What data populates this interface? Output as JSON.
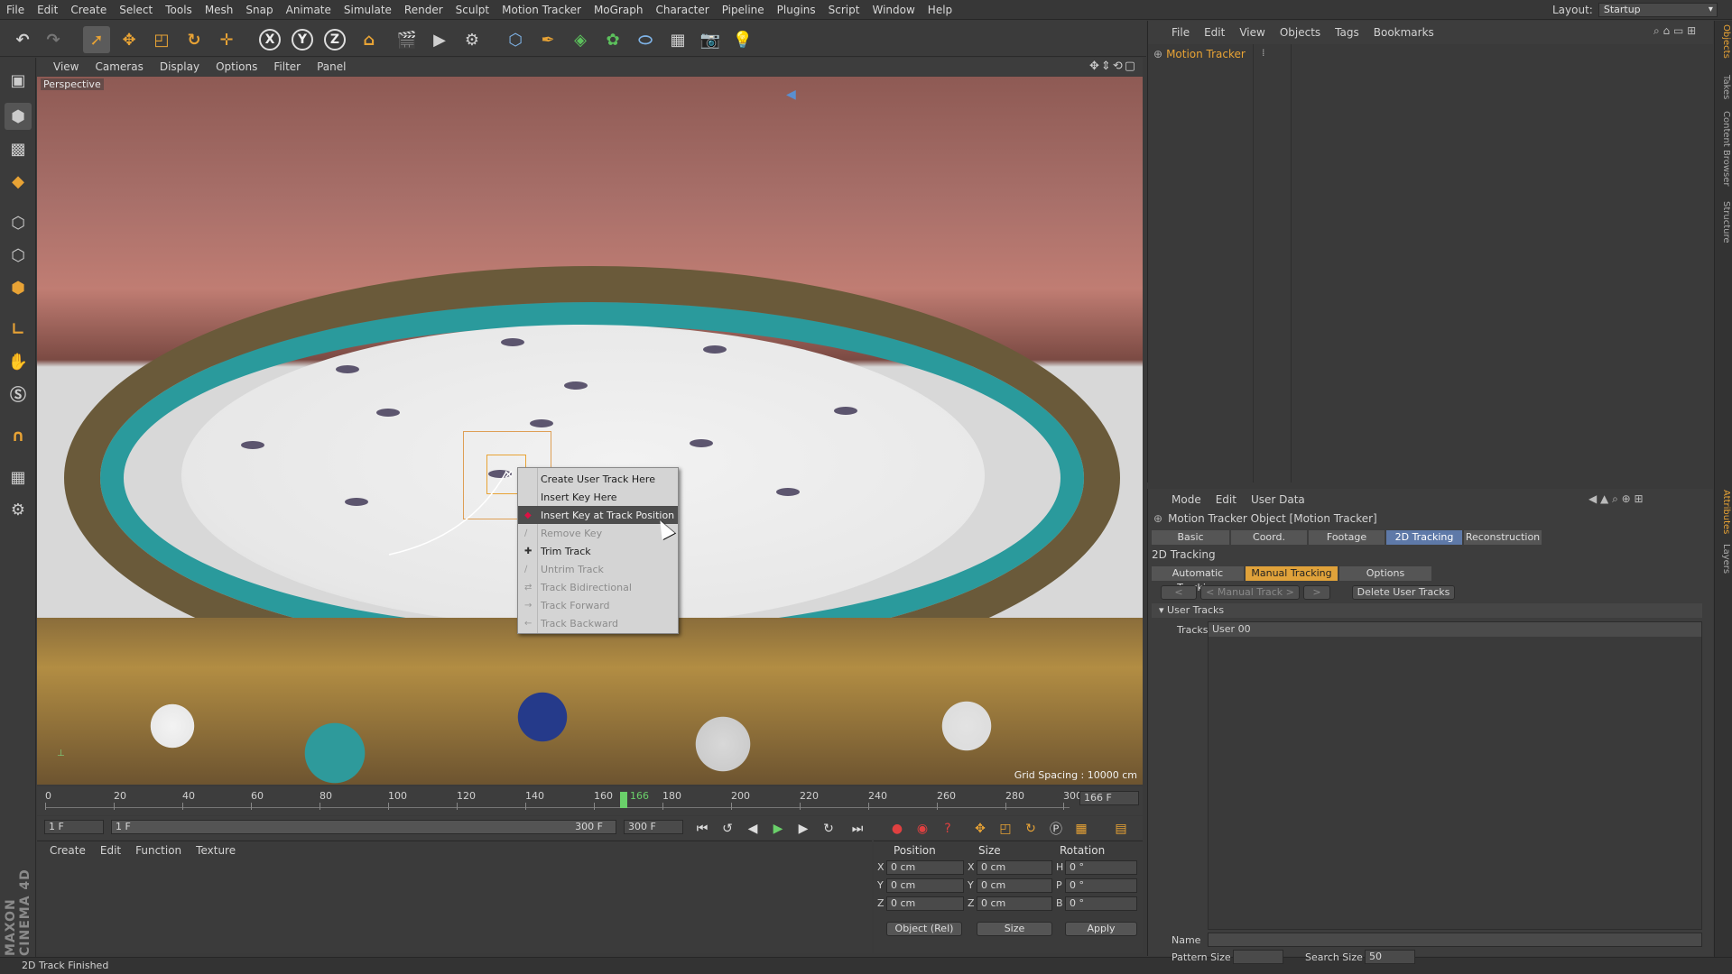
{
  "menubar": {
    "items": [
      "File",
      "Edit",
      "Create",
      "Select",
      "Tools",
      "Mesh",
      "Snap",
      "Animate",
      "Simulate",
      "Render",
      "Sculpt",
      "Motion Tracker",
      "MoGraph",
      "Character",
      "Pipeline",
      "Plugins",
      "Script",
      "Window",
      "Help"
    ],
    "layout_label": "Layout:",
    "layout_value": "Startup"
  },
  "toolbar": {
    "coord_x": "X",
    "coord_y": "Y",
    "coord_z": "Z"
  },
  "viewport": {
    "menu": [
      "View",
      "Cameras",
      "Display",
      "Options",
      "Filter",
      "Panel"
    ],
    "label": "Perspective",
    "grid_spacing": "Grid Spacing : 10000 cm"
  },
  "context_menu": {
    "items": [
      {
        "label": "Create User Track Here",
        "enabled": true
      },
      {
        "label": "Insert Key Here",
        "enabled": true
      },
      {
        "label": "Insert Key at Track Position",
        "enabled": true,
        "highlighted": true
      },
      {
        "label": "Remove Key",
        "enabled": false
      },
      {
        "label": "Trim Track",
        "enabled": true
      },
      {
        "label": "Untrim Track",
        "enabled": false
      },
      {
        "label": "Track Bidirectional",
        "enabled": false
      },
      {
        "label": "Track Forward",
        "enabled": false
      },
      {
        "label": "Track Backward",
        "enabled": false
      }
    ]
  },
  "timeline": {
    "ticks": [
      "0",
      "20",
      "40",
      "60",
      "80",
      "100",
      "120",
      "140",
      "160",
      "180",
      "200",
      "220",
      "240",
      "260",
      "280",
      "300"
    ],
    "current_frame": "166",
    "end_field": "166 F"
  },
  "transport": {
    "start_frame": "1 F",
    "range_start": "1 F",
    "range_end": "300 F",
    "end_frame": "300 F"
  },
  "materials": {
    "menu": [
      "Create",
      "Edit",
      "Function",
      "Texture"
    ]
  },
  "coords": {
    "headers": {
      "position": "Position",
      "size": "Size",
      "rotation": "Rotation"
    },
    "rows": [
      {
        "axis": "X",
        "pos": "0 cm",
        "size_axis": "X",
        "size": "0 cm",
        "rot_axis": "H",
        "rot": "0 °"
      },
      {
        "axis": "Y",
        "pos": "0 cm",
        "size_axis": "Y",
        "size": "0 cm",
        "rot_axis": "P",
        "rot": "0 °"
      },
      {
        "axis": "Z",
        "pos": "0 cm",
        "size_axis": "Z",
        "size": "0 cm",
        "rot_axis": "B",
        "rot": "0 °"
      }
    ],
    "mode": "Object (Rel)",
    "size_mode": "Size",
    "apply": "Apply"
  },
  "status": "2D Track Finished",
  "object_manager": {
    "menu": [
      "File",
      "Edit",
      "View",
      "Objects",
      "Tags",
      "Bookmarks"
    ],
    "object_name": "Motion Tracker"
  },
  "attributes": {
    "menu": [
      "Mode",
      "Edit",
      "User Data"
    ],
    "title": "Motion Tracker Object [Motion Tracker]",
    "tabs": [
      "Basic",
      "Coord.",
      "Footage",
      "2D Tracking",
      "Reconstruction"
    ],
    "active_tab": "2D Tracking",
    "section": "2D Tracking",
    "subtabs": [
      "Automatic Tracking",
      "Manual Tracking",
      "Options"
    ],
    "prev_btn": "<",
    "manual_track": "< Manual Track >",
    "next_btn": ">",
    "delete_tracks": "Delete User Tracks",
    "group": "User Tracks",
    "tracks_label": "Tracks",
    "track_item": "User 00",
    "name_label": "Name",
    "pattern_size_label": "Pattern Size",
    "search_size_label": "Search Size",
    "search_size_value": "50"
  },
  "right_tabs": [
    "Objects",
    "Takes",
    "Content Browser",
    "Structure",
    "Attributes",
    "Layers"
  ],
  "maxon_logo": "MAXON CINEMA 4D"
}
